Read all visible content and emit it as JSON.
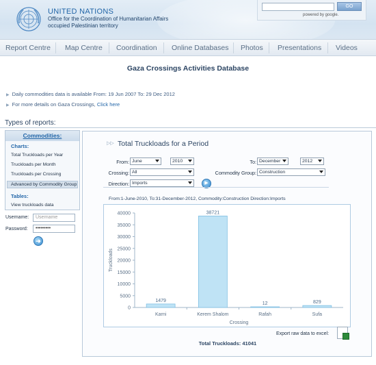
{
  "header": {
    "org_title": "UNITED NATIONS",
    "org_line2": "Office for the Coordination of Humanitarian Affairs",
    "org_line3": "occupied Palestinian territory",
    "search": {
      "placeholder": "",
      "go_label": "GO",
      "powered_by": "powered by google."
    }
  },
  "nav": {
    "items": [
      "Report Centre",
      "Map Centre",
      "Coordination",
      "Online Databases",
      "Photos",
      "Presentations",
      "Videos"
    ]
  },
  "page_title": "Gaza Crossings Activities Database",
  "info": {
    "line1": "Daily commodities data is available From: 19 Jun 2007 To: 29 Dec 2012",
    "line2_text": "For more details on Gaza Crossings,",
    "line2_link": "Click here"
  },
  "types_label": "Types of reports:",
  "sidebar": {
    "heading": "Commodities:",
    "charts_label": "Charts:",
    "charts": [
      "Total Truckloads per Year",
      "Truckloads per Month",
      "Truckloads per Crossing",
      "Advanced by Commodity Group"
    ],
    "tables_label": "Tables:",
    "tables": [
      "View truckloads data"
    ]
  },
  "login": {
    "username_label": "Username:",
    "username_placeholder": "Username",
    "password_label": "Password:",
    "password_value": "•••••••••"
  },
  "report": {
    "title": "Total Truckloads for a Period",
    "from_label": "From:",
    "from_month": "June",
    "from_year": "2010",
    "to_label": "To:",
    "to_month": "December",
    "to_year": "2012",
    "crossing_label": "Crossing:",
    "crossing_value": "All",
    "commodity_label": "Commodity Group:",
    "commodity_value": "Construction",
    "direction_label": "Direction:",
    "direction_value": "Imports",
    "caption": "From:1-June-2010, To:31-December-2012, Commodity:Construction Direction:Imports",
    "export_label": "Export raw data to excel:",
    "total_label": "Total Truckloads: 41041"
  },
  "chart_data": {
    "type": "bar",
    "categories": [
      "Karni",
      "Kerem Shalom",
      "Rafah",
      "Sufa"
    ],
    "values": [
      1479,
      38721,
      12,
      829
    ],
    "value_labels": [
      "1479",
      "38721",
      "12",
      "829"
    ],
    "xlabel": "Crossing",
    "ylabel": "Truckloads",
    "ylim": [
      0,
      40000
    ],
    "yticks": [
      0,
      5000,
      10000,
      15000,
      20000,
      25000,
      30000,
      35000,
      40000
    ],
    "grid": false,
    "bar_color": "#bfe3f5",
    "bar_edge_color": "#7fbfe3"
  },
  "colors": {
    "accent": "#2366a8",
    "nav_text": "#5a6f86",
    "panel_border": "#b7c8d9"
  }
}
